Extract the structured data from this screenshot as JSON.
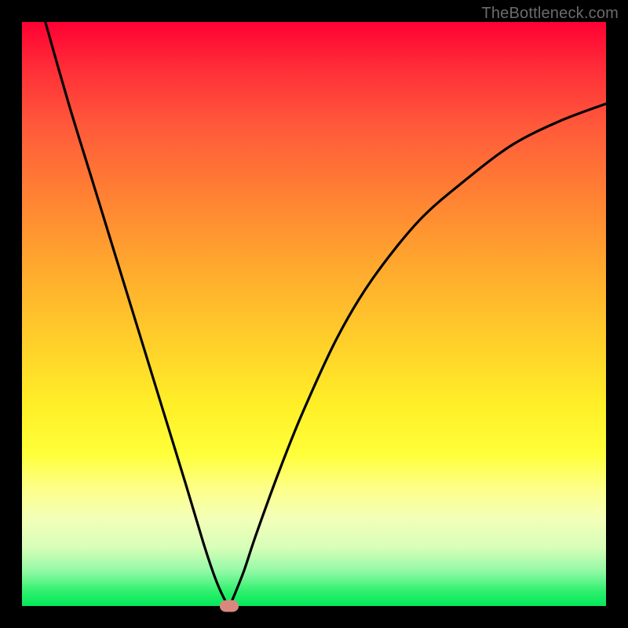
{
  "watermark": "TheBottleneck.com",
  "colors": {
    "frame": "#000000",
    "curve": "#000000",
    "marker": "#d98880",
    "gradient_top": "#ff0033",
    "gradient_bottom": "#04e85a"
  },
  "chart_data": {
    "type": "line",
    "title": "",
    "xlabel": "",
    "ylabel": "",
    "xlim": [
      0,
      100
    ],
    "ylim": [
      0,
      100
    ],
    "grid": false,
    "legend": false,
    "series": [
      {
        "name": "bottleneck-curve",
        "x": [
          4,
          8,
          12,
          16,
          20,
          24,
          28,
          31,
          33,
          34.5,
          35.5,
          36,
          38,
          40,
          44,
          48,
          54,
          60,
          68,
          76,
          84,
          92,
          100
        ],
        "y": [
          100,
          86,
          73,
          60,
          47,
          34,
          21,
          11,
          5,
          1.5,
          0,
          1,
          6,
          12,
          23,
          33,
          46,
          56,
          66,
          73,
          79,
          83,
          86
        ]
      }
    ],
    "marker": {
      "x": 35.5,
      "y": 0
    }
  }
}
